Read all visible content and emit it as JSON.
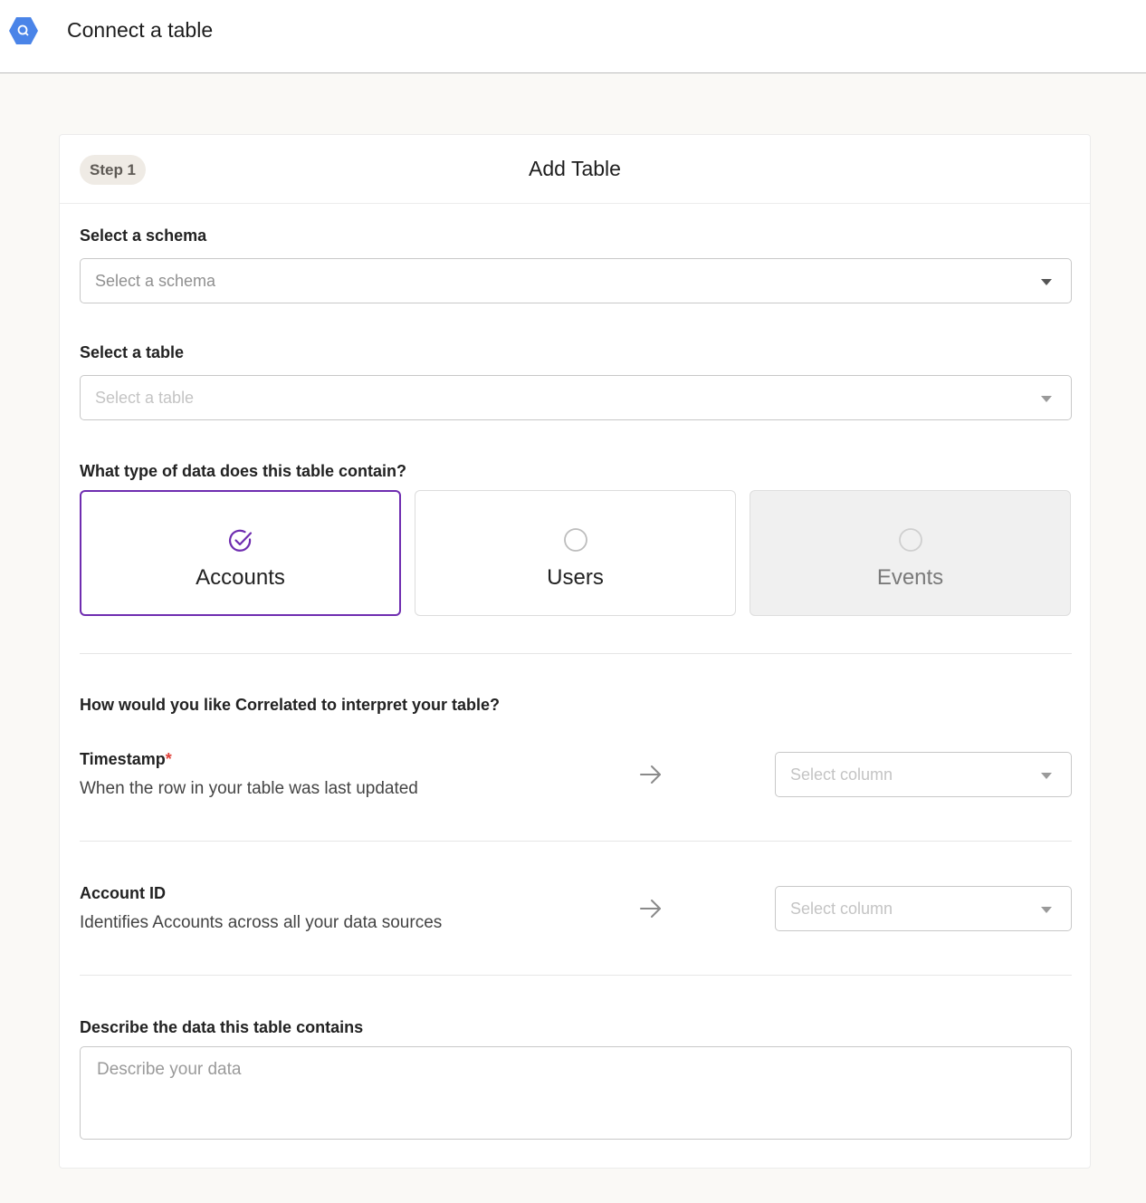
{
  "header": {
    "title": "Connect a table",
    "logo_icon": "bigquery-icon",
    "logo_color": "#4a84e8"
  },
  "card": {
    "step_badge": "Step 1",
    "title": "Add Table"
  },
  "schema": {
    "label": "Select a schema",
    "placeholder": "Select a schema"
  },
  "table": {
    "label": "Select a table",
    "placeholder": "Select a table",
    "disabled": true
  },
  "data_type": {
    "question": "What type of data does this table contain?",
    "options": [
      {
        "label": "Accounts",
        "state": "selected",
        "icon": "check-circle-icon"
      },
      {
        "label": "Users",
        "state": "unselected",
        "icon": "radio-empty-icon"
      },
      {
        "label": "Events",
        "state": "disabled",
        "icon": "radio-empty-icon"
      }
    ],
    "accent_color": "#6f2db0"
  },
  "interpret": {
    "question": "How would you like Correlated to interpret your table?",
    "mappings": [
      {
        "title": "Timestamp",
        "required_mark": "*",
        "description": "When the row in your table was last updated",
        "placeholder": "Select column"
      },
      {
        "title": "Account ID",
        "required_mark": "",
        "description": "Identifies Accounts across all your data sources",
        "placeholder": "Select column"
      }
    ]
  },
  "describe": {
    "label": "Describe the data this table contains",
    "placeholder": "Describe your data"
  }
}
